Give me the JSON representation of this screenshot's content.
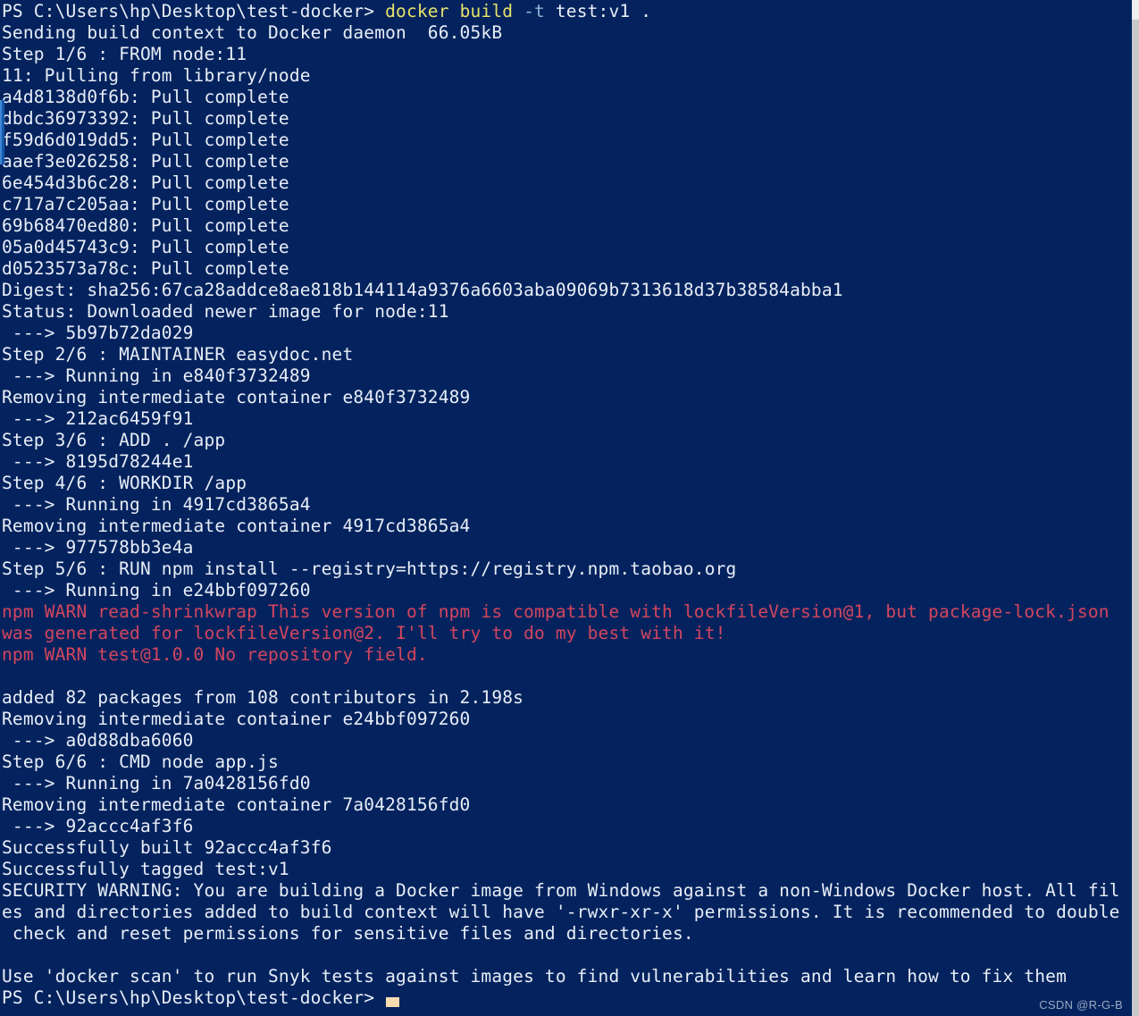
{
  "window": {
    "type": "powershell-terminal",
    "background_color": "#04235E",
    "foreground_color": "#e8eef7",
    "warning_color": "#d4455e",
    "command_color": "#e8e36a",
    "flag_color": "#8fb4d4",
    "cursor_color": "#f7dcae",
    "scrollbar_color": "#c8c8c8"
  },
  "prompt": {
    "text": "PS C:\\Users\\hp\\Desktop\\test-docker>",
    "command_name": "docker build",
    "command_flag": "-t",
    "command_args": "test:v1 ."
  },
  "watermark": "CSDN @R-G-B",
  "lines": [
    {
      "id": "line-prompt-command",
      "segments": [
        {
          "text": "PS C:\\Users\\hp\\Desktop\\test-docker> ",
          "color": "white"
        },
        {
          "text": "docker build ",
          "color": "yellow"
        },
        {
          "text": "-t ",
          "color": "cyan"
        },
        {
          "text": "test:v1 .",
          "color": "white"
        }
      ]
    },
    {
      "id": "line-sending-context",
      "segments": [
        {
          "text": "Sending build context to Docker daemon  66.05kB",
          "color": "white"
        }
      ]
    },
    {
      "id": "line-step-1",
      "segments": [
        {
          "text": "Step 1/6 : FROM node:11",
          "color": "white"
        }
      ]
    },
    {
      "id": "line-pulling",
      "segments": [
        {
          "text": "11: Pulling from library/node",
          "color": "white"
        }
      ]
    },
    {
      "id": "line-pull-1",
      "segments": [
        {
          "text": "a4d8138d0f6b: Pull complete",
          "color": "white"
        }
      ]
    },
    {
      "id": "line-pull-2",
      "segments": [
        {
          "text": "dbdc36973392: Pull complete",
          "color": "white"
        }
      ]
    },
    {
      "id": "line-pull-3",
      "segments": [
        {
          "text": "f59d6d019dd5: Pull complete",
          "color": "white"
        }
      ]
    },
    {
      "id": "line-pull-4",
      "segments": [
        {
          "text": "aaef3e026258: Pull complete",
          "color": "white"
        }
      ]
    },
    {
      "id": "line-pull-5",
      "segments": [
        {
          "text": "6e454d3b6c28: Pull complete",
          "color": "white"
        }
      ]
    },
    {
      "id": "line-pull-6",
      "segments": [
        {
          "text": "c717a7c205aa: Pull complete",
          "color": "white"
        }
      ]
    },
    {
      "id": "line-pull-7",
      "segments": [
        {
          "text": "69b68470ed80: Pull complete",
          "color": "white"
        }
      ]
    },
    {
      "id": "line-pull-8",
      "segments": [
        {
          "text": "05a0d45743c9: Pull complete",
          "color": "white"
        }
      ]
    },
    {
      "id": "line-pull-9",
      "segments": [
        {
          "text": "d0523573a78c: Pull complete",
          "color": "white"
        }
      ]
    },
    {
      "id": "line-digest",
      "segments": [
        {
          "text": "Digest: sha256:67ca28addce8ae818b144114a9376a6603aba09069b7313618d37b38584abba1",
          "color": "white"
        }
      ]
    },
    {
      "id": "line-status",
      "segments": [
        {
          "text": "Status: Downloaded newer image for node:11",
          "color": "white"
        }
      ]
    },
    {
      "id": "line-layer-1",
      "segments": [
        {
          "text": " ---> 5b97b72da029",
          "color": "white"
        }
      ]
    },
    {
      "id": "line-step-2",
      "segments": [
        {
          "text": "Step 2/6 : MAINTAINER easydoc.net",
          "color": "white"
        }
      ]
    },
    {
      "id": "line-running-1",
      "segments": [
        {
          "text": " ---> Running in e840f3732489",
          "color": "white"
        }
      ]
    },
    {
      "id": "line-removing-1",
      "segments": [
        {
          "text": "Removing intermediate container e840f3732489",
          "color": "white"
        }
      ]
    },
    {
      "id": "line-layer-2",
      "segments": [
        {
          "text": " ---> 212ac6459f91",
          "color": "white"
        }
      ]
    },
    {
      "id": "line-step-3",
      "segments": [
        {
          "text": "Step 3/6 : ADD . /app",
          "color": "white"
        }
      ]
    },
    {
      "id": "line-layer-3",
      "segments": [
        {
          "text": " ---> 8195d78244e1",
          "color": "white"
        }
      ]
    },
    {
      "id": "line-step-4",
      "segments": [
        {
          "text": "Step 4/6 : WORKDIR /app",
          "color": "white"
        }
      ]
    },
    {
      "id": "line-running-2",
      "segments": [
        {
          "text": " ---> Running in 4917cd3865a4",
          "color": "white"
        }
      ]
    },
    {
      "id": "line-removing-2",
      "segments": [
        {
          "text": "Removing intermediate container 4917cd3865a4",
          "color": "white"
        }
      ]
    },
    {
      "id": "line-layer-4",
      "segments": [
        {
          "text": " ---> 977578bb3e4a",
          "color": "white"
        }
      ]
    },
    {
      "id": "line-step-5",
      "segments": [
        {
          "text": "Step 5/6 : RUN npm install --registry=https://registry.npm.taobao.org",
          "color": "white"
        }
      ]
    },
    {
      "id": "line-running-3",
      "segments": [
        {
          "text": " ---> Running in e24bbf097260",
          "color": "white"
        }
      ]
    },
    {
      "id": "line-npm-warn-1a",
      "segments": [
        {
          "text": "npm WARN read-shrinkwrap This version of npm is compatible with lockfileVersion@1, but package-lock.json",
          "color": "red"
        }
      ]
    },
    {
      "id": "line-npm-warn-1b",
      "segments": [
        {
          "text": "was generated for lockfileVersion@2. I'll try to do my best with it!",
          "color": "red"
        }
      ]
    },
    {
      "id": "line-npm-warn-2",
      "segments": [
        {
          "text": "npm WARN test@1.0.0 No repository field.",
          "color": "red"
        }
      ]
    },
    {
      "id": "line-blank-1",
      "segments": [
        {
          "text": " ",
          "color": "white"
        }
      ]
    },
    {
      "id": "line-added-packages",
      "segments": [
        {
          "text": "added 82 packages from 108 contributors in 2.198s",
          "color": "white"
        }
      ]
    },
    {
      "id": "line-removing-3",
      "segments": [
        {
          "text": "Removing intermediate container e24bbf097260",
          "color": "white"
        }
      ]
    },
    {
      "id": "line-layer-5",
      "segments": [
        {
          "text": " ---> a0d88dba6060",
          "color": "white"
        }
      ]
    },
    {
      "id": "line-step-6",
      "segments": [
        {
          "text": "Step 6/6 : CMD node app.js",
          "color": "white"
        }
      ]
    },
    {
      "id": "line-running-4",
      "segments": [
        {
          "text": " ---> Running in 7a0428156fd0",
          "color": "white"
        }
      ]
    },
    {
      "id": "line-removing-4",
      "segments": [
        {
          "text": "Removing intermediate container 7a0428156fd0",
          "color": "white"
        }
      ]
    },
    {
      "id": "line-layer-6",
      "segments": [
        {
          "text": " ---> 92accc4af3f6",
          "color": "white"
        }
      ]
    },
    {
      "id": "line-built",
      "segments": [
        {
          "text": "Successfully built 92accc4af3f6",
          "color": "white"
        }
      ]
    },
    {
      "id": "line-tagged",
      "segments": [
        {
          "text": "Successfully tagged test:v1",
          "color": "white"
        }
      ]
    },
    {
      "id": "line-security-warning-1",
      "segments": [
        {
          "text": "SECURITY WARNING: You are building a Docker image from Windows against a non-Windows Docker host. All fil",
          "color": "white"
        }
      ]
    },
    {
      "id": "line-security-warning-2",
      "segments": [
        {
          "text": "es and directories added to build context will have '-rwxr-xr-x' permissions. It is recommended to double",
          "color": "white"
        }
      ]
    },
    {
      "id": "line-security-warning-3",
      "segments": [
        {
          "text": " check and reset permissions for sensitive files and directories.",
          "color": "white"
        }
      ]
    },
    {
      "id": "line-blank-2",
      "segments": [
        {
          "text": " ",
          "color": "white"
        }
      ]
    },
    {
      "id": "line-docker-scan-tip",
      "segments": [
        {
          "text": "Use 'docker scan' to run Snyk tests against images to find vulnerabilities and learn how to fix them",
          "color": "white"
        }
      ]
    },
    {
      "id": "line-final-prompt",
      "segments": [
        {
          "text": "PS C:\\Users\\hp\\Desktop\\test-docker> ",
          "color": "white"
        }
      ]
    }
  ]
}
